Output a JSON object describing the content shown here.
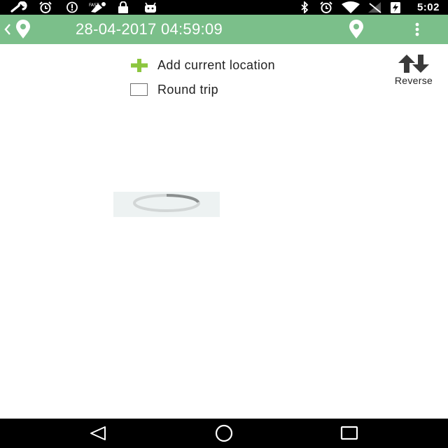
{
  "status_bar": {
    "time": "5:02",
    "left_icons": [
      "wrench-icon",
      "alarm-icon",
      "data-saver-icon",
      "location-service-icon",
      "lock-icon",
      "android-icon"
    ],
    "right_icons": [
      "bluetooth-icon",
      "alarm-icon",
      "wifi-icon",
      "no-signal-icon",
      "battery-charging-icon"
    ]
  },
  "toolbar": {
    "title": "28-04-2017 04:59:09",
    "background_color": "#7bbf8a",
    "icons": [
      "back-chevron-icon",
      "app-location-pin-icon",
      "location-pin-icon",
      "overflow-menu-icon"
    ]
  },
  "content": {
    "add_location_label": "Add current location",
    "add_icon_color": "#8cc63f",
    "round_trip_label": "Round trip",
    "round_trip_checked": false,
    "reverse_label": "Reverse"
  },
  "loading": {
    "icon": "loading-spinner-icon"
  },
  "nav_bar": {
    "buttons": [
      "back-triangle-icon",
      "home-circle-icon",
      "recents-square-icon"
    ]
  }
}
